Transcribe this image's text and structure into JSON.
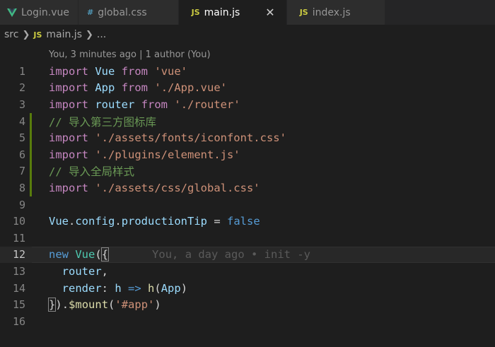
{
  "tabs": [
    {
      "label": "Login.vue",
      "icon": "vue-icon"
    },
    {
      "label": "global.css",
      "icon": "css-icon"
    },
    {
      "label": "main.js",
      "icon": "js-icon",
      "active": true
    },
    {
      "label": "index.js",
      "icon": "js-icon"
    }
  ],
  "tab_icon_text": {
    "js": "JS",
    "css": "#"
  },
  "breadcrumb": {
    "folder": "src",
    "file": "main.js",
    "more": "..."
  },
  "codelens": "You, 3 minutes ago | 1 author (You)",
  "line_numbers": [
    "1",
    "2",
    "3",
    "4",
    "5",
    "6",
    "7",
    "8",
    "9",
    "10",
    "11",
    "12",
    "13",
    "14",
    "15",
    "16"
  ],
  "code": {
    "l1": {
      "import": "import",
      "name": "Vue",
      "from": "from",
      "path": "'vue'"
    },
    "l2": {
      "import": "import",
      "name": "App",
      "from": "from",
      "path": "'./App.vue'"
    },
    "l3": {
      "import": "import",
      "name": "router",
      "from": "from",
      "path": "'./router'"
    },
    "l4": {
      "comment": "// 导入第三方图标库"
    },
    "l5": {
      "import": "import",
      "path": "'./assets/fonts/iconfont.css'"
    },
    "l6": {
      "import": "import",
      "path": "'./plugins/element.js'"
    },
    "l7": {
      "comment": "// 导入全局样式"
    },
    "l8": {
      "import": "import",
      "path": "'./assets/css/global.css'"
    },
    "l10": {
      "obj": "Vue",
      "dot1": ".",
      "prop1": "config",
      "dot2": ".",
      "prop2": "productionTip",
      "eq": " = ",
      "val": "false"
    },
    "l12": {
      "new": "new",
      "cls": "Vue",
      "open": "(",
      "brace": "{",
      "blame": "You, a day ago • init -y"
    },
    "l13": {
      "prop": "router",
      "comma": ","
    },
    "l14": {
      "prop": "render",
      "colon": ": ",
      "param": "h",
      "arrow": " => ",
      "fn": "h",
      "open": "(",
      "arg": "App",
      "close": ")"
    },
    "l15": {
      "brace": "}",
      "close": ")",
      "dot": ".",
      "method": "$mount",
      "open": "(",
      "arg": "'#app'",
      "close2": ")"
    }
  },
  "colors": {
    "keyword": "#c586c0",
    "variable": "#9cdcfe",
    "string": "#ce9178",
    "comment": "#6a9955",
    "class": "#4ec9b0",
    "function": "#dcdcaa",
    "git_modified": "#587c0c"
  }
}
